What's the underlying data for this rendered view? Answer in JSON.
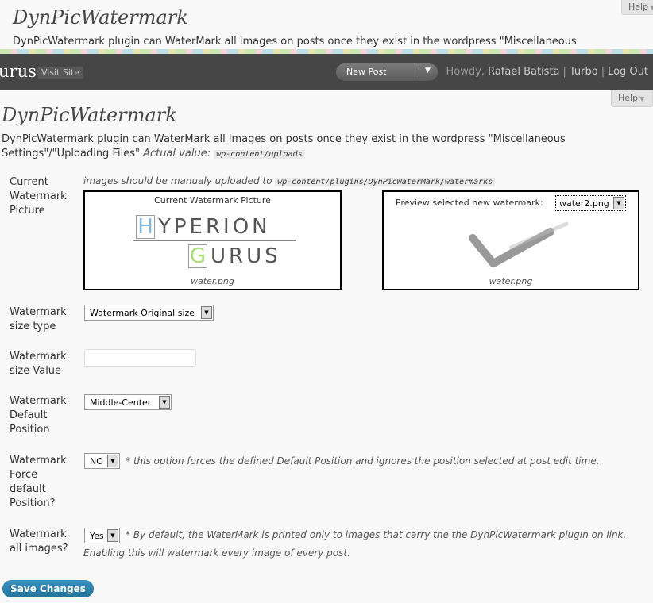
{
  "background_page": {
    "title": "DynPicWatermark",
    "description": "DynPicWatermark plugin can WaterMark all images on posts once they exist in the wordpress \"Miscellaneous",
    "help_label": "Help"
  },
  "admin_bar": {
    "site_name": "urus",
    "visit_site": "Visit Site",
    "new_post": "New Post",
    "howdy_prefix": "Howdy,",
    "user_name": "Rafael Batista",
    "link_turbo": "Turbo",
    "link_logout": "Log Out"
  },
  "help_label": "Help",
  "page": {
    "title": "DynPicWatermark",
    "description": "DynPicWatermark plugin can WaterMark all images on posts once they exist in the wordpress \"Miscellaneous Settings\"/\"Uploading Files\"",
    "actual_value_label": "Actual value:",
    "actual_value": "wp-content/uploads"
  },
  "form": {
    "current_watermark": {
      "label": "Current Watermark Picture",
      "note_prefix": "images should be manualy uploaded to",
      "note_path": "wp-content/plugins/DynPicWaterMark/watermarks",
      "current_box_caption": "Current Watermark Picture",
      "current_file": "water.png",
      "logo_line1_letter": "H",
      "logo_line1_rest": "YPERION",
      "logo_line2_letter": "G",
      "logo_line2_rest": "URUS",
      "preview_label": "Preview selected new watermark:",
      "preview_selected": "water2.png",
      "preview_file": "water.png"
    },
    "size_type": {
      "label": "Watermark size type",
      "selected": "Watermark Original size"
    },
    "size_value": {
      "label": "Watermark size Value",
      "value": ""
    },
    "default_position": {
      "label": "Watermark Default Position",
      "selected": "Middle-Center"
    },
    "force_default": {
      "label": "Watermark Force default Position?",
      "selected": "NO",
      "note": "* this option forces the defined Default Position and ignores the position selected at post edit time."
    },
    "all_images": {
      "label": "Watermark all images?",
      "selected": "Yes",
      "note_line1": "* By default, the WaterMark is printed only to images that carry the the DynPicWatermark plugin on link.",
      "note_line2": "Enabling this will watermark every image of every post."
    }
  },
  "save_button": "Save Changes",
  "colors": {
    "admin_bar": "#464646",
    "primary_button": "#21759b",
    "logo_h": "#7fb9e0",
    "logo_g": "#a6e06a"
  }
}
